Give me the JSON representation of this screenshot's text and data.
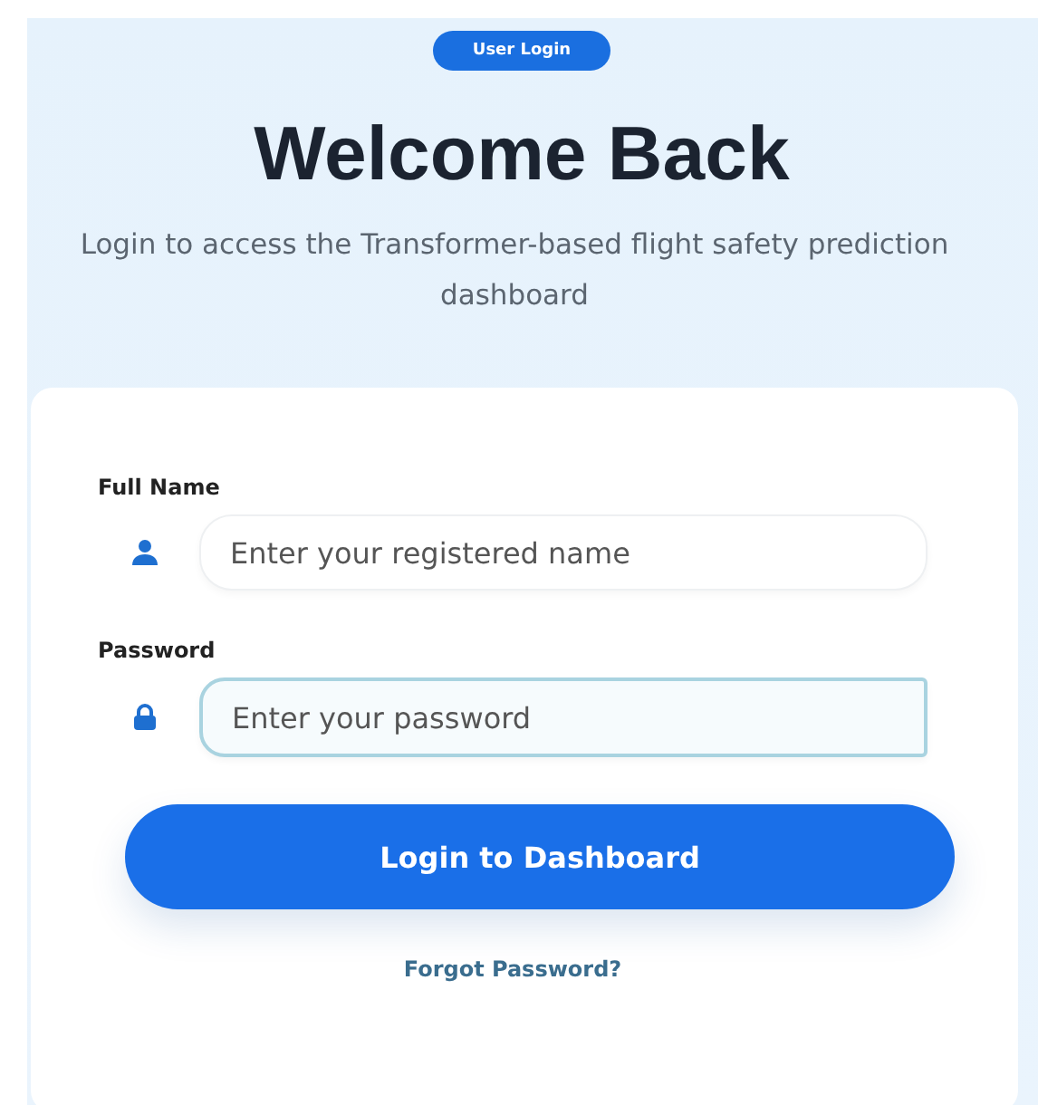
{
  "badge": "User Login",
  "title": "Welcome Back",
  "subtitle": "Login to access the Transformer-based flight safety prediction dashboard",
  "fields": [
    {
      "label": "Full Name",
      "kind": "name",
      "placeholder": "Enter your registered name",
      "focused": false
    },
    {
      "label": "Password",
      "kind": "password",
      "placeholder": "Enter your password",
      "focused": true
    }
  ],
  "submit": "Login to Dashboard",
  "forgot": "Forgot Password?"
}
